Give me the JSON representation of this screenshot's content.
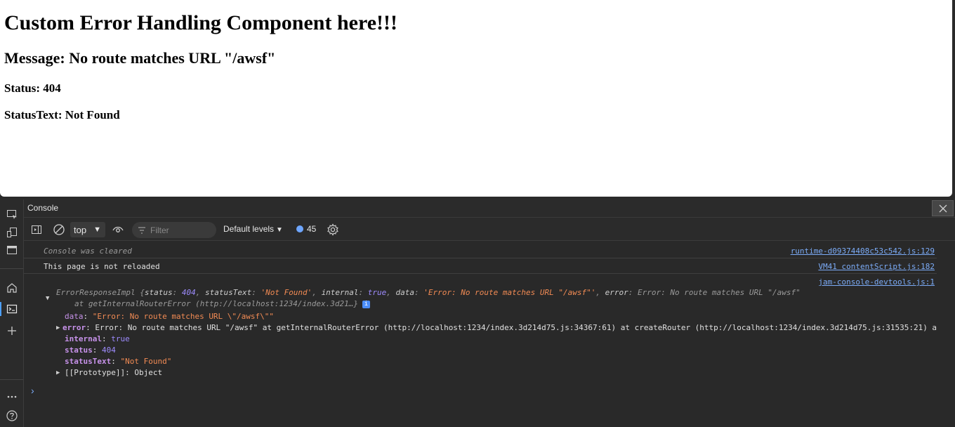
{
  "page": {
    "heading": "Custom Error Handling Component here!!!",
    "message": "Message: No route matches URL \"/awsf\"",
    "status": "Status: 404",
    "status_text": "StatusText: Not Found"
  },
  "activity_bar": {
    "icons": [
      "inspect-icon",
      "device-icon",
      "dock-icon",
      "home-icon",
      "console-icon",
      "add-icon",
      "more-icon",
      "help-icon"
    ]
  },
  "console": {
    "panel_title": "Console",
    "toolbar": {
      "context": "top",
      "filter_placeholder": "Filter",
      "levels": "Default levels",
      "issues_count": "45"
    },
    "messages": [
      {
        "text": "Console was cleared",
        "source": "runtime-d09374408c53c542.js:129"
      },
      {
        "text": "This page is not reloaded",
        "source": "VM41 contentScript.js:182"
      }
    ],
    "object_log": {
      "source": "jam-console-devtools.js:1",
      "summary": {
        "cls": "ErrorResponseImpl {",
        "k_status": "status",
        "v_status": "404",
        "k_statusText": "statusText",
        "v_statusText": "'Not Found'",
        "k_internal": "internal",
        "v_internal": "true",
        "k_data": "data",
        "v_data": "'Error: No route matches URL \"/awsf\"'",
        "k_error": "error",
        "v_error": "Error: No route matches URL \"/awsf\"",
        "line2": "at getInternalRouterError (http://localhost:1234/index.3d21…}"
      },
      "props": {
        "data_key": "data",
        "data_val": "\"Error: No route matches URL \\\"/awsf\\\"\"",
        "error_key": "error",
        "error_val": "Error: No route matches URL \"/awsf\" at getInternalRouterError (http://localhost:1234/index.3d214d75.js:34367:61) at createRouter (http://localhost:1234/index.3d214d75.js:31535:21) a",
        "internal_key": "internal",
        "internal_val": "true",
        "status_key": "status",
        "status_val": "404",
        "statusText_key": "statusText",
        "statusText_val": "\"Not Found\"",
        "proto_key": "[[Prototype]]",
        "proto_val": "Object"
      }
    },
    "prompt": "›"
  },
  "colors": {
    "accent": "#4d9ff5",
    "link": "#7cacf8",
    "string": "#f28b54",
    "number": "#9e8cff"
  }
}
